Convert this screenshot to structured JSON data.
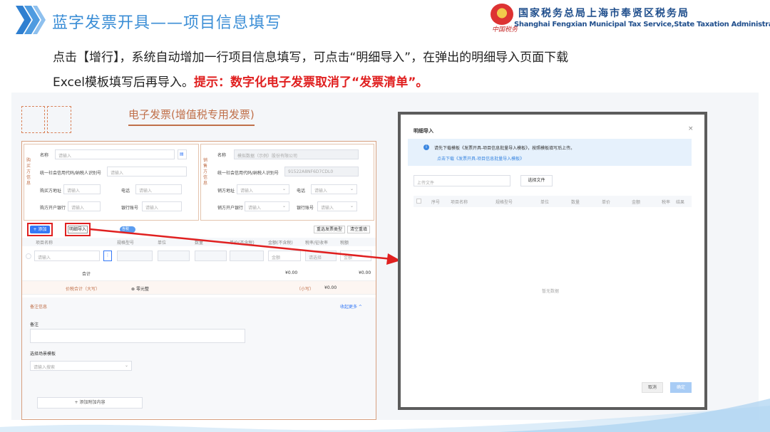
{
  "slide": {
    "title": "蓝字发票开具——项目信息填写",
    "org_cn": "国家税务总局上海市奉贤区税务局",
    "org_en": "Shanghai Fengxian Municipal Tax Service,State Taxation Administration",
    "org_script": "中国税务",
    "desc_line1": "点击【增行】，系统自动增加一行项目信息填写，可点击“明细导入”，在弹出的明细导入页面下载",
    "desc_line2": "Excel模板填写后再导入。",
    "tip": "提示：数字化电子发票取消了“发票清单”。",
    "accent": "#3b8ed6",
    "tip_color": "#e02020"
  },
  "invoice": {
    "title": "电子发票(增值税专用发票)",
    "buyer_side": "购买方信息",
    "seller_side": "销售方信息",
    "buyer": {
      "name_label": "名称",
      "name_placeholder": "请输入",
      "tax_label": "统一社会信用代码/纳税人识别号",
      "tax_placeholder": "请输入",
      "addr_label": "购买方地址",
      "addr_placeholder": "请输入",
      "phone_label": "电话",
      "phone_placeholder": "请输入",
      "bank_label": "购方开户银行",
      "bank_placeholder": "请输入",
      "acct_label": "银行账号",
      "acct_placeholder": "请输入"
    },
    "seller": {
      "name_label": "名称",
      "name_value": "模拟数据（示例）股份有限公司",
      "tax_label": "统一社会信用代码/纳税人识别号",
      "tax_value": "91522A8NF6D7CDL0",
      "addr_label": "销方地址",
      "addr_placeholder": "请输入",
      "phone_label": "电话",
      "phone_placeholder": "请输入",
      "bank_label": "销方开户银行",
      "bank_placeholder": "请输入",
      "acct_label": "银行账号",
      "acct_placeholder": "请输入"
    },
    "toolbar": {
      "add_label": "+ 添加",
      "detail_import_label": "明细导入",
      "toggle_label": "含税",
      "reselect_type": "重选发票类型",
      "clear_label": "清空重填"
    },
    "columns": [
      "项目名称",
      "规格型号",
      "单位",
      "数量",
      "单价(不含税)",
      "金额(不含税)",
      "税率/征收率",
      "税额"
    ],
    "row": {
      "name_placeholder": "请输入",
      "tax_rate": "请选择",
      "amount_placeholder": "金额",
      "tax_amount_placeholder": "金额"
    },
    "subtotal_label": "合计",
    "subtotal_amount": "¥0.00",
    "subtotal_tax": "¥0.00",
    "total_label": "价税合计（大写）",
    "total_words": "零元整",
    "small_label": "（小写）",
    "small_amount": "¥0.00",
    "remark_section": "备注信息",
    "collapse_label": "收起更多 ^",
    "remark_label": "备注",
    "scene_label": "选择场景模板",
    "scene_placeholder": "请输入搜索",
    "add_attach": "+ 添加附加内容"
  },
  "modal": {
    "title": "明细导入",
    "close": "×",
    "info_text": "请先下载模板《发票开具-项目信息批量导入模板》，按照模板填写后上传。",
    "info_link": "点击下载《发票开具-项目信息批量导入模板》",
    "upload_placeholder": "上传文件",
    "choose_file": "选择文件",
    "columns": [
      "序号",
      "项目名称",
      "规格型号",
      "单位",
      "数量",
      "单价",
      "金额",
      "税率",
      "结果"
    ],
    "empty_text": "暂无数据",
    "cancel": "取消",
    "confirm": "确定"
  }
}
